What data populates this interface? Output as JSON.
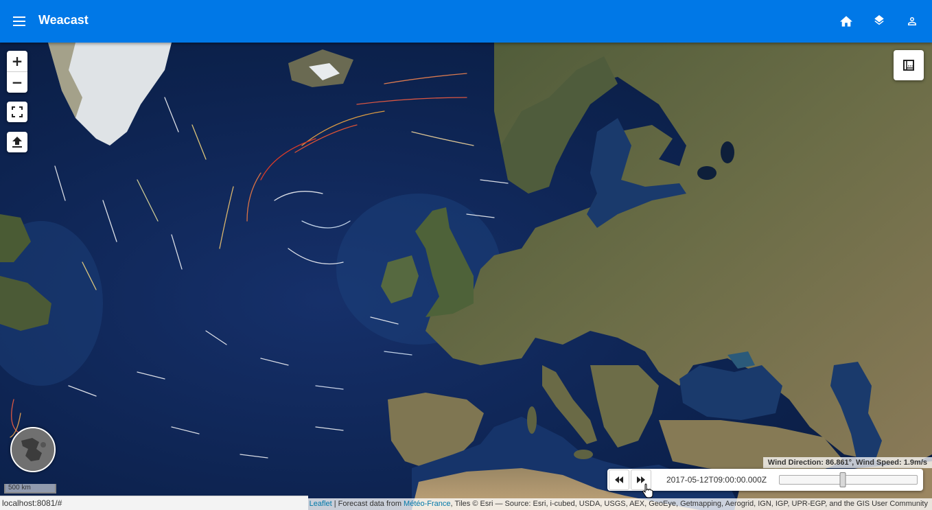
{
  "app": {
    "title": "Weacast",
    "bar_color": "#0078e7"
  },
  "header_actions": [
    {
      "name": "home-icon"
    },
    {
      "name": "layers-icon"
    },
    {
      "name": "account-icon"
    }
  ],
  "map_controls": {
    "zoom_in": "+",
    "zoom_out": "−",
    "fullscreen_icon": "fullscreen-icon",
    "upload_icon": "upload-icon",
    "legend_icon": "legend-icon"
  },
  "scale": {
    "label": "500 km"
  },
  "wind_info": {
    "text": "Wind Direction: 86.861°, Wind Speed: 1.9m/s"
  },
  "time_control": {
    "back_icon": "rewind-icon",
    "forward_icon": "fast-forward-icon",
    "datetime": "2017-05-12T09:00:00.000Z",
    "slider_position_fraction": 0.46
  },
  "status_bar": {
    "url": "localhost:8081/#"
  },
  "attribution": {
    "leaflet_link": "Leaflet",
    "forecast_prefix": " | Forecast data from ",
    "meteo_link": "Météo-France",
    "tiles_text": ", Tiles © Esri — Source: Esri, i-cubed, USDA, USGS, AEX, GeoEye, Getmapping, Aerogrid, IGN, IGP, UPR-EGP, and the GIS User Community"
  }
}
